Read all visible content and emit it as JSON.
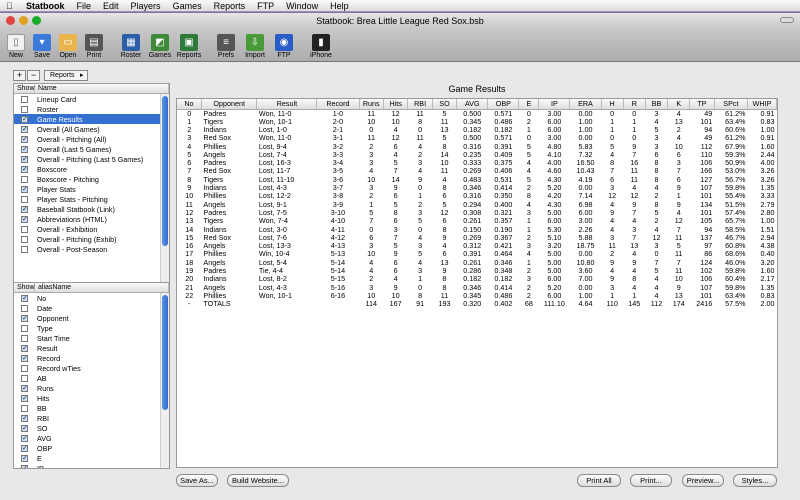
{
  "menubar": {
    "app": "Statbook",
    "items": [
      "File",
      "Edit",
      "Players",
      "Games",
      "Reports",
      "FTP",
      "Window",
      "Help"
    ]
  },
  "window": {
    "title": "Statbook: Brea Little League Red Sox.bsb"
  },
  "toolbar": {
    "items": [
      {
        "label": "New",
        "icon": "new-icon",
        "color": "#f2f2f2"
      },
      {
        "label": "Save",
        "icon": "save-icon",
        "color": "#3b7ad8"
      },
      {
        "label": "Open",
        "icon": "folder-icon",
        "color": "#e9b44c"
      },
      {
        "label": "Print",
        "icon": "printer-icon",
        "color": "#555555"
      },
      {
        "label": "Roster",
        "icon": "roster-icon",
        "color": "#2d5ea8"
      },
      {
        "label": "Games",
        "icon": "games-icon",
        "color": "#3f8a3a"
      },
      {
        "label": "Reports",
        "icon": "reports-icon",
        "color": "#2e7a3a"
      },
      {
        "label": "Prefs",
        "icon": "prefs-icon",
        "color": "#555555"
      },
      {
        "label": "Import",
        "icon": "import-icon",
        "color": "#4a9a3a"
      },
      {
        "label": "FTP",
        "icon": "globe-icon",
        "color": "#2a5cc8"
      },
      {
        "label": "iPhone",
        "icon": "iphone-icon",
        "color": "#222222"
      }
    ]
  },
  "left_controls": {
    "add": "+",
    "remove": "−",
    "popup": "Reports"
  },
  "reports_list": {
    "headers": [
      "Show",
      "Name"
    ],
    "items": [
      {
        "name": "Lineup Card",
        "checked": false
      },
      {
        "name": "Roster",
        "checked": false
      },
      {
        "name": "Game Results",
        "checked": true,
        "selected": true
      },
      {
        "name": "Overall (All Games)",
        "checked": true
      },
      {
        "name": "Overall - Pitching (All)",
        "checked": true
      },
      {
        "name": "Overall (Last 5 Games)",
        "checked": true
      },
      {
        "name": "Overall - Pitching (Last 5 Games)",
        "checked": true
      },
      {
        "name": "Boxscore",
        "checked": true
      },
      {
        "name": "Boxscore - Pitching",
        "checked": false
      },
      {
        "name": "Player Stats",
        "checked": true
      },
      {
        "name": "Player Stats - Pitching",
        "checked": false
      },
      {
        "name": "Baseball Statbook (Link)",
        "checked": true
      },
      {
        "name": "Abbreviations (HTML)",
        "checked": true
      },
      {
        "name": "Overall - Exhibition",
        "checked": false
      },
      {
        "name": "Overall - Pitching (Exhib)",
        "checked": false
      },
      {
        "name": "Overall - Post-Season",
        "checked": false
      }
    ]
  },
  "columns_list": {
    "headers": [
      "Show",
      "aliasName"
    ],
    "items": [
      {
        "name": "No",
        "checked": true
      },
      {
        "name": "Date",
        "checked": false
      },
      {
        "name": "Opponent",
        "checked": true
      },
      {
        "name": "Type",
        "checked": false
      },
      {
        "name": "Start Time",
        "checked": false
      },
      {
        "name": "Result",
        "checked": true
      },
      {
        "name": "Record",
        "checked": true
      },
      {
        "name": "Record wTies",
        "checked": false
      },
      {
        "name": "AB",
        "checked": false
      },
      {
        "name": "Runs",
        "checked": true
      },
      {
        "name": "Hits",
        "checked": true
      },
      {
        "name": "BB",
        "checked": false
      },
      {
        "name": "RBI",
        "checked": true
      },
      {
        "name": "SO",
        "checked": true
      },
      {
        "name": "AVG",
        "checked": true
      },
      {
        "name": "OBP",
        "checked": true
      },
      {
        "name": "E",
        "checked": true
      },
      {
        "name": "IP",
        "checked": true
      }
    ]
  },
  "results": {
    "title": "Game Results",
    "headers": [
      "No",
      "Opponent",
      "Result",
      "Record",
      "Runs",
      "Hits",
      "RBI",
      "SO",
      "AVG",
      "OBP",
      "E",
      "IP",
      "ERA",
      "H",
      "R",
      "BB",
      "K",
      "TP",
      "SPct",
      "WHIP"
    ],
    "rows": [
      [
        "0",
        "Padres",
        "Won, 11-0",
        "1-0",
        "11",
        "12",
        "11",
        "5",
        "0.500",
        "0.571",
        "0",
        "3.00",
        "0.00",
        "0",
        "0",
        "3",
        "4",
        "49",
        "61.2%",
        "0.91"
      ],
      [
        "1",
        "Tigers",
        "Won, 10-1",
        "2-0",
        "10",
        "10",
        "8",
        "11",
        "0.345",
        "0.486",
        "2",
        "6.00",
        "1.00",
        "1",
        "1",
        "4",
        "13",
        "101",
        "63.4%",
        "0.83"
      ],
      [
        "2",
        "Indians",
        "Lost, 1-0",
        "2-1",
        "0",
        "4",
        "0",
        "13",
        "0.182",
        "0.182",
        "1",
        "6.00",
        "1.00",
        "1",
        "1",
        "5",
        "2",
        "94",
        "60.6%",
        "1.00"
      ],
      [
        "3",
        "Red Sox",
        "Won, 11-0",
        "3-1",
        "11",
        "12",
        "11",
        "5",
        "0.500",
        "0.571",
        "0",
        "3.00",
        "0.00",
        "0",
        "0",
        "3",
        "4",
        "49",
        "61.2%",
        "0.91"
      ],
      [
        "4",
        "Phillies",
        "Lost, 9-4",
        "3-2",
        "2",
        "6",
        "4",
        "8",
        "0.316",
        "0.391",
        "5",
        "4.80",
        "5.83",
        "5",
        "9",
        "3",
        "10",
        "112",
        "67.9%",
        "1.60"
      ],
      [
        "5",
        "Angels",
        "Lost, 7-4",
        "3-3",
        "3",
        "4",
        "2",
        "14",
        "0.235",
        "0.409",
        "5",
        "4.10",
        "7.32",
        "4",
        "7",
        "6",
        "6",
        "110",
        "59.3%",
        "2.44"
      ],
      [
        "6",
        "Padres",
        "Lost, 16-3",
        "3-4",
        "3",
        "5",
        "3",
        "10",
        "0.333",
        "0.375",
        "4",
        "4.00",
        "16.50",
        "8",
        "16",
        "8",
        "3",
        "106",
        "50.9%",
        "4.00"
      ],
      [
        "7",
        "Red Sox",
        "Lost, 11-7",
        "3-5",
        "4",
        "7",
        "4",
        "11",
        "0.269",
        "0.406",
        "4",
        "4.60",
        "10.43",
        "7",
        "11",
        "8",
        "7",
        "166",
        "53.0%",
        "3.26"
      ],
      [
        "8",
        "Tigers",
        "Lost, 11-10",
        "3-6",
        "10",
        "14",
        "9",
        "4",
        "0.483",
        "0.531",
        "5",
        "4.30",
        "4.19",
        "6",
        "11",
        "8",
        "6",
        "127",
        "56.7%",
        "3.26"
      ],
      [
        "9",
        "Indians",
        "Lost, 4-3",
        "3-7",
        "3",
        "9",
        "0",
        "8",
        "0.346",
        "0.414",
        "2",
        "5.20",
        "0.00",
        "3",
        "4",
        "4",
        "9",
        "107",
        "59.8%",
        "1.35"
      ],
      [
        "10",
        "Phillies",
        "Lost, 12-2",
        "3-8",
        "2",
        "6",
        "1",
        "6",
        "0.316",
        "0.350",
        "8",
        "4.20",
        "7.14",
        "12",
        "12",
        "2",
        "1",
        "101",
        "55.4%",
        "3.33"
      ],
      [
        "11",
        "Angels",
        "Lost, 9-1",
        "3-9",
        "1",
        "5",
        "2",
        "5",
        "0.294",
        "0.400",
        "4",
        "4.30",
        "6.98",
        "4",
        "9",
        "8",
        "9",
        "134",
        "51.5%",
        "2.79"
      ],
      [
        "12",
        "Padres",
        "Lost, 7-5",
        "3-10",
        "5",
        "8",
        "3",
        "12",
        "0.308",
        "0.321",
        "3",
        "5.00",
        "6.00",
        "9",
        "7",
        "5",
        "4",
        "101",
        "57.4%",
        "2.80"
      ],
      [
        "13",
        "Tigers",
        "Won, 7-4",
        "4-10",
        "7",
        "6",
        "5",
        "6",
        "0.261",
        "0.357",
        "1",
        "6.00",
        "3.00",
        "4",
        "4",
        "2",
        "12",
        "105",
        "65.7%",
        "1.00"
      ],
      [
        "14",
        "Indians",
        "Lost, 3-0",
        "4-11",
        "0",
        "3",
        "0",
        "8",
        "0.150",
        "0.190",
        "1",
        "5.30",
        "2.26",
        "4",
        "3",
        "4",
        "7",
        "94",
        "58.5%",
        "1.51"
      ],
      [
        "15",
        "Red Sox",
        "Lost, 7-6",
        "4-12",
        "6",
        "7",
        "4",
        "9",
        "0.269",
        "0.367",
        "2",
        "5.10",
        "5.88",
        "3",
        "7",
        "12",
        "11",
        "137",
        "46.7%",
        "2.94"
      ],
      [
        "16",
        "Angels",
        "Lost, 13-3",
        "4-13",
        "3",
        "5",
        "3",
        "4",
        "0.312",
        "0.421",
        "3",
        "3.20",
        "18.75",
        "11",
        "13",
        "3",
        "5",
        "97",
        "60.8%",
        "4.38"
      ],
      [
        "17",
        "Phillies",
        "Win, 10-4",
        "5-13",
        "10",
        "9",
        "5",
        "6",
        "0.391",
        "0.464",
        "4",
        "5.00",
        "0.00",
        "2",
        "4",
        "0",
        "11",
        "86",
        "68.6%",
        "0.40"
      ],
      [
        "18",
        "Angels",
        "Lost, 5-4",
        "5-14",
        "4",
        "6",
        "4",
        "13",
        "0.261",
        "0.346",
        "1",
        "5.00",
        "10.80",
        "9",
        "9",
        "7",
        "7",
        "124",
        "46.0%",
        "3.20"
      ],
      [
        "19",
        "Padres",
        "Tie, 4-4",
        "5-14",
        "4",
        "6",
        "3",
        "9",
        "0.286",
        "0.348",
        "2",
        "5.00",
        "3.60",
        "4",
        "4",
        "5",
        "11",
        "102",
        "59.8%",
        "1.60"
      ],
      [
        "20",
        "Indians",
        "Lost, 8-2",
        "5-15",
        "2",
        "4",
        "1",
        "8",
        "0.182",
        "0.182",
        "3",
        "6.00",
        "7.00",
        "9",
        "8",
        "4",
        "10",
        "106",
        "60.4%",
        "2.17"
      ],
      [
        "21",
        "Angels",
        "Lost, 4-3",
        "5-16",
        "3",
        "9",
        "0",
        "8",
        "0.346",
        "0.414",
        "2",
        "5.20",
        "0.00",
        "3",
        "4",
        "4",
        "9",
        "107",
        "59.8%",
        "1.35"
      ],
      [
        "22",
        "Phillies",
        "Won, 10-1",
        "6-16",
        "10",
        "10",
        "8",
        "11",
        "0.345",
        "0.486",
        "2",
        "6.00",
        "1.00",
        "1",
        "1",
        "4",
        "13",
        "101",
        "63.4%",
        "0.83"
      ],
      [
        "-",
        "TOTALS",
        "",
        "",
        "114",
        "167",
        "91",
        "193",
        "0.320",
        "0.402",
        "68",
        "111.10",
        "4.64",
        "110",
        "145",
        "112",
        "174",
        "2416",
        "57.5%",
        "2.00"
      ]
    ]
  },
  "buttons": {
    "save_as": "Save As...",
    "build": "Build Website...",
    "print_all": "Print All",
    "print": "Print...",
    "preview": "Preview...",
    "styles": "Styles..."
  }
}
